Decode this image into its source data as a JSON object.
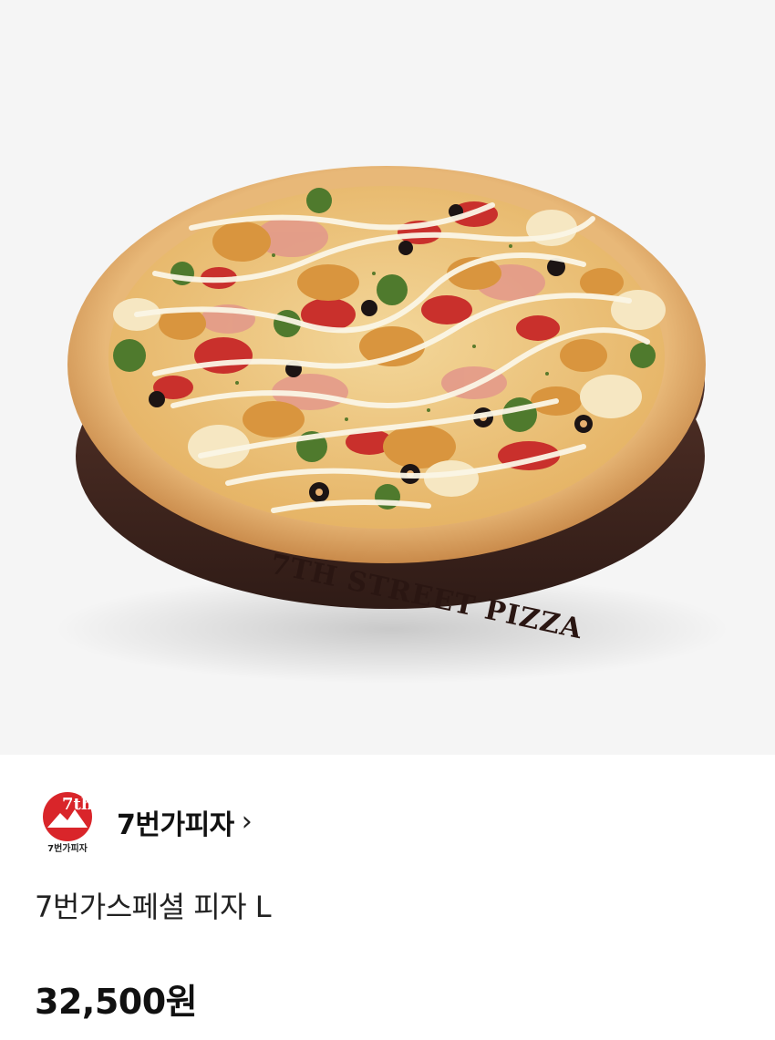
{
  "product": {
    "image_alt_brand_text": "7TH STREET PIZZA",
    "store": {
      "logo_text_top": "7th",
      "logo_text_bottom": "7번가피자",
      "name": "7번가피자",
      "chevron": "›"
    },
    "name": "7번가스페셜 피자 L",
    "price": "32,500원"
  },
  "colors": {
    "hero_background": "#f5f5f5",
    "logo_red": "#d9252a",
    "tray_brown": "#3f2620",
    "crust": "#d9a060"
  },
  "icons": {
    "store_logo": "7th-street-pizza-logo",
    "store_chevron": "chevron-right-icon"
  }
}
